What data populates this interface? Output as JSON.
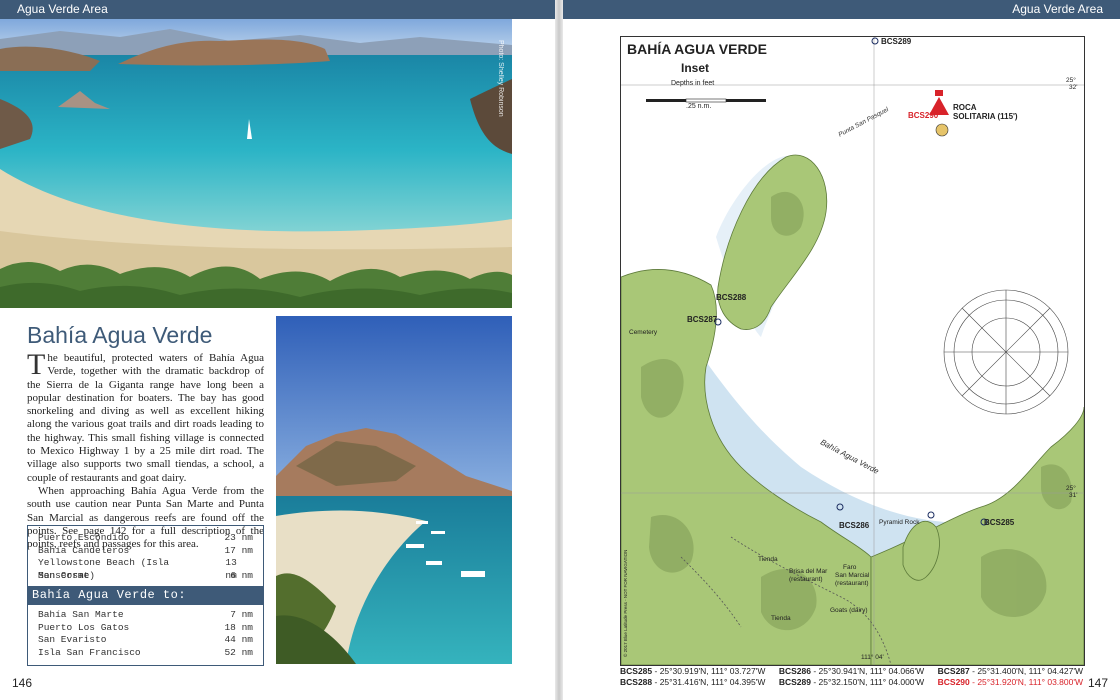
{
  "left": {
    "running_head": "Agua Verde Area",
    "folio": "146",
    "photo_credit": "Photo: Shelley Robinson",
    "heading": "Bahía Agua Verde",
    "paragraphs": [
      "The beautiful, protected waters of Bahía Agua Verde, together with the dramatic backdrop of the Sierra de la Giganta range have long been a popular destination for boaters. The bay has good snorkeling and diving as well as excellent hiking along the various goat trails and dirt roads leading to the highway. This small fishing village is connected to Mexico Highway 1 by a 25 mile dirt road. The village also supports two small tiendas, a school, a couple of restaurants and goat dairy.",
      "When approaching Bahía Agua Verde from the south use caution near Punta San Marte and Punta San Marcial as dangerous reefs are found off the points. See page 142 for a full description of the points, reefs and passages for this area."
    ],
    "distances_from": [
      {
        "place": "Puerto Escondido",
        "nm": "23 nm"
      },
      {
        "place": "Bahía Candeleros",
        "nm": "17 nm"
      },
      {
        "place": "Yellowstone Beach (Isla Monserrat)",
        "nm": "13 nm"
      },
      {
        "place": "San Cosme",
        "nm": "6 nm"
      }
    ],
    "band_label": "Bahía Agua Verde to:",
    "distances_to": [
      {
        "place": "Bahía San Marte",
        "nm": "7 nm"
      },
      {
        "place": "Puerto Los Gatos",
        "nm": "18 nm"
      },
      {
        "place": "San Evaristo",
        "nm": "44 nm"
      },
      {
        "place": "Isla San Francisco",
        "nm": "52 nm"
      }
    ]
  },
  "right": {
    "running_head": "Agua Verde Area",
    "folio": "147",
    "chart": {
      "title": "BAHÍA AGUA VERDE",
      "subtitle": "Inset",
      "depth_note": "Depths in feet",
      "scale": ".25 n.m.",
      "bay_label": "Bahía Agua Verde",
      "labels": {
        "punta": "Punta San Pasquel",
        "roca": "ROCA",
        "roca2": "SOLITARIA (115')",
        "cemetery": "Cemetery",
        "tienda1": "Tienda",
        "tienda2": "Tienda",
        "brisa": "Brisa del Mar",
        "brisa2": "(restaurant)",
        "faro": "Faro",
        "faro2": "San Marcial",
        "faro3": "(restaurant)",
        "goats": "Goats (dairy)",
        "pyramid": "Pyramid Rock",
        "lat1": "25°",
        "lat1b": "32'",
        "lat2": "25°",
        "lat2b": "31'",
        "lon": "111° 04'",
        "copyright": "© 2017 Blue Latitude Press - NOT FOR NAVIGATION"
      },
      "waypoints": {
        "bcs285": "BCS285",
        "bcs286": "BCS286",
        "bcs287": "BCS287",
        "bcs288": "BCS288",
        "bcs289": "BCS289",
        "bcs290": "BCS290"
      }
    },
    "coords": [
      [
        {
          "id": "BCS285",
          "pos": " - 25°30.919'N, 111° 03.727'W",
          "red": false
        },
        {
          "id": "BCS286",
          "pos": " - 25°30.941'N, 111° 04.066'W",
          "red": false
        },
        {
          "id": "BCS287",
          "pos": " - 25°31.400'N, 111° 04.427'W",
          "red": false
        }
      ],
      [
        {
          "id": "BCS288",
          "pos": " - 25°31.416'N, 111° 04.395'W",
          "red": false
        },
        {
          "id": "BCS289",
          "pos": " - 25°32.150'N, 111° 04.000'W",
          "red": false
        },
        {
          "id": "BCS290",
          "pos": " - 25°31.920'N, 111° 03.800'W",
          "red": true
        }
      ]
    ]
  },
  "colors": {
    "band": "#3e5a78",
    "land": "#a9c777",
    "shallow": "#cfe3f1",
    "deep": "#ffffff",
    "hazard": "#d8232a"
  }
}
